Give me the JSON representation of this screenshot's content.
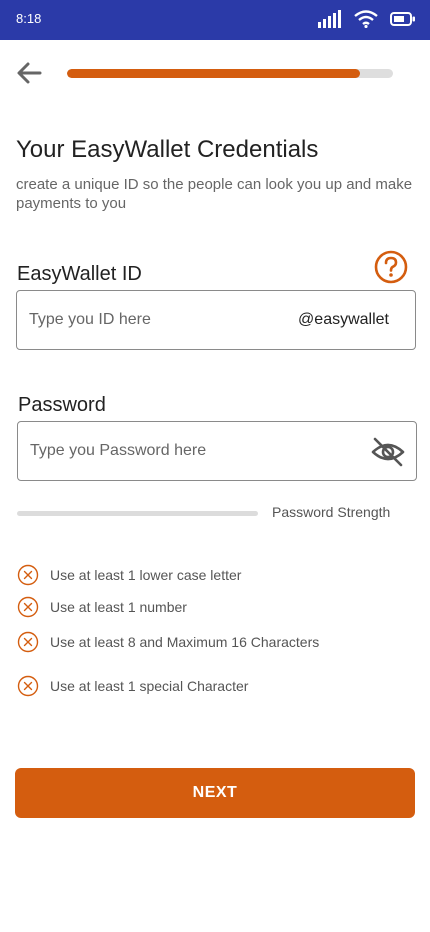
{
  "status_bar": {
    "time": "8:18",
    "icons": [
      "signal-icon",
      "wifi-icon",
      "battery-icon"
    ]
  },
  "header": {
    "back_icon": "arrow-left-icon",
    "progress_fraction": 0.9
  },
  "title": "Your EasyWallet Credentials",
  "subtitle": "create a unique ID so the people can look you up and make payments to you",
  "id_field": {
    "label": "EasyWallet ID",
    "placeholder": "Type you ID here",
    "suffix": "@easywallet",
    "help_icon": "question-circle-icon"
  },
  "password_field": {
    "label": "Password",
    "placeholder": "Type you Password here",
    "visibility_icon": "eye-off-icon"
  },
  "strength": {
    "label": "Password Strength",
    "level": 0
  },
  "rules": [
    {
      "text": "Use at least 1 lower case letter",
      "met": false
    },
    {
      "text": "Use at least 1 number",
      "met": false
    },
    {
      "text": "Use at least 8 and Maximum 16 Characters",
      "met": false
    },
    {
      "text": "Use at least 1 special Character",
      "met": false
    }
  ],
  "next_button": "NEXT",
  "colors": {
    "accent": "#d45d0f",
    "status_bar": "#2b3aa8"
  }
}
